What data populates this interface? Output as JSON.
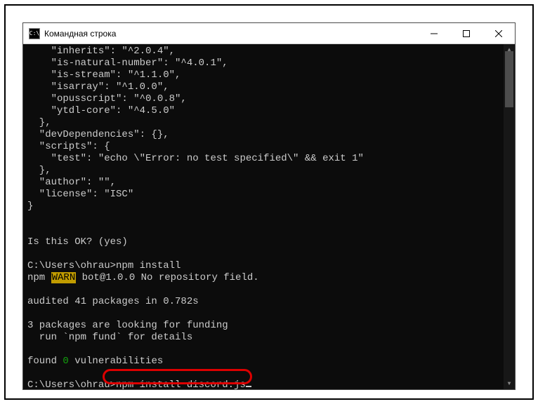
{
  "window": {
    "title": "Командная строка",
    "icon_label": "C:\\"
  },
  "json_output": {
    "lines": [
      "    \"inherits\": \"^2.0.4\",",
      "    \"is-natural-number\": \"^4.0.1\",",
      "    \"is-stream\": \"^1.1.0\",",
      "    \"isarray\": \"^1.0.0\",",
      "    \"opusscript\": \"^0.0.8\",",
      "    \"ytdl-core\": \"^4.5.0\"",
      "  },",
      "  \"devDependencies\": {},",
      "  \"scripts\": {",
      "    \"test\": \"echo \\\"Error: no test specified\\\" && exit 1\"",
      "  },",
      "  \"author\": \"\",",
      "  \"license\": \"ISC\"",
      "}"
    ]
  },
  "prompt_confirm": "Is this OK? (yes)",
  "install": {
    "prompt": "C:\\Users\\ohrau>npm install",
    "warn_prefix": "npm ",
    "warn_badge": "WARN",
    "warn_rest": " bot@1.0.0 No repository field.",
    "audit": "audited 41 packages in 0.782s",
    "funding1": "3 packages are looking for funding",
    "funding2": "  run `npm fund` for details",
    "found_prefix": "found ",
    "found_count": "0",
    "found_suffix": " vulnerabilities"
  },
  "current": {
    "prompt": "C:\\Users\\ohrau>",
    "command": "npm install discord.js"
  }
}
